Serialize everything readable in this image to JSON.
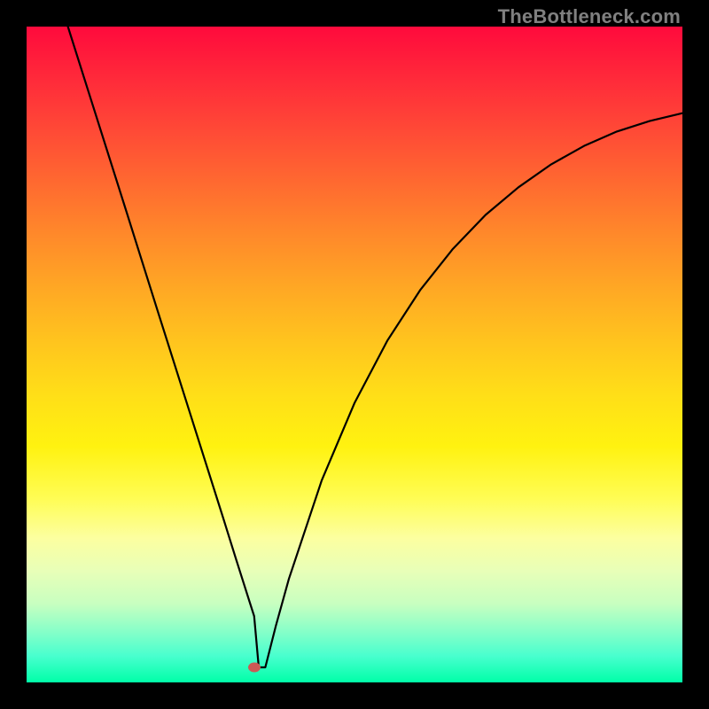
{
  "watermark": "TheBottleneck.com",
  "marker_color": "#cc5a55",
  "curve_color": "#000000",
  "curve_width": 2.2,
  "chart_data": {
    "type": "line",
    "title": "",
    "xlabel": "",
    "ylabel": "",
    "xlim": [
      0,
      100
    ],
    "ylim": [
      0,
      100
    ],
    "grid": false,
    "legend_position": "none",
    "series": [
      {
        "name": "curve",
        "x": [
          6.3,
          10,
          15,
          20,
          25,
          30,
          32,
          34,
          34.7,
          35.4,
          36.4,
          38,
          40,
          45,
          50,
          55,
          60,
          65,
          70,
          75,
          80,
          85,
          90,
          95,
          100
        ],
        "y": [
          100,
          88.3,
          72.5,
          56.6,
          40.8,
          25.0,
          18.6,
          12.3,
          10.1,
          2.3,
          2.3,
          8.6,
          15.8,
          30.8,
          42.6,
          52.1,
          59.8,
          66.1,
          71.3,
          75.5,
          79.0,
          81.8,
          84.0,
          85.6,
          86.8
        ]
      }
    ],
    "marker": {
      "x": 34.7,
      "y": 2.3
    },
    "gradient_stops": [
      {
        "pos": 0,
        "color": "#ff0a3c"
      },
      {
        "pos": 50,
        "color": "#ffd21e"
      },
      {
        "pos": 100,
        "color": "#00ffa8"
      }
    ]
  }
}
